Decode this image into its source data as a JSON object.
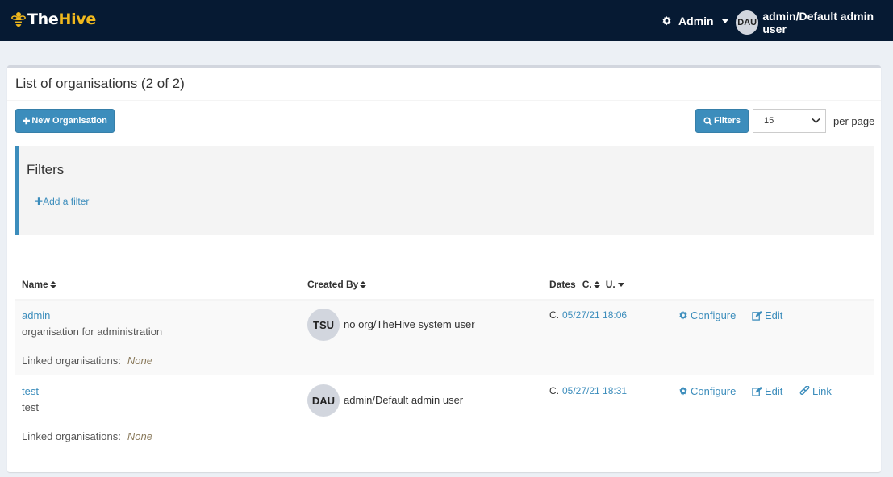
{
  "app": {
    "logo_the": "The",
    "logo_hive": "Hive"
  },
  "navbar": {
    "admin_label": "Admin",
    "user_initials": "DAU",
    "user_label": "admin/Default admin user"
  },
  "box": {
    "title": "List of organisations (2 of 2)"
  },
  "toolbar": {
    "new_org_label": "New Organisation",
    "filters_label": "Filters",
    "page_size": "15",
    "per_page_label": "per page"
  },
  "filters": {
    "title": "Filters",
    "add_filter_label": "Add a filter"
  },
  "table": {
    "headers": {
      "name": "Name",
      "created_by": "Created By",
      "dates": "Dates",
      "dates_c": "C.",
      "dates_u": "U."
    },
    "rows": [
      {
        "name": "admin",
        "description": "organisation for administration",
        "linked_label": "Linked organisations:",
        "linked_value": "None",
        "creator_initials": "TSU",
        "creator": "no org/TheHive system user",
        "date_prefix": "C.",
        "date": "05/27/21 18:06",
        "configure": "Configure",
        "edit": "Edit"
      },
      {
        "name": "test",
        "description": "test",
        "linked_label": "Linked organisations:",
        "linked_value": "None",
        "creator_initials": "DAU",
        "creator": "admin/Default admin user",
        "date_prefix": "C.",
        "date": "05/27/21 18:31",
        "configure": "Configure",
        "edit": "Edit",
        "link": "Link"
      }
    ]
  },
  "colors": {
    "navbar": "#061a33",
    "accent": "#3c8dbc",
    "logo_accent": "#f0b81d"
  },
  "icons": [
    "bee-icon",
    "gear-icon",
    "plus-icon",
    "search-icon",
    "chevron-down-icon",
    "edit-icon",
    "link-icon"
  ]
}
